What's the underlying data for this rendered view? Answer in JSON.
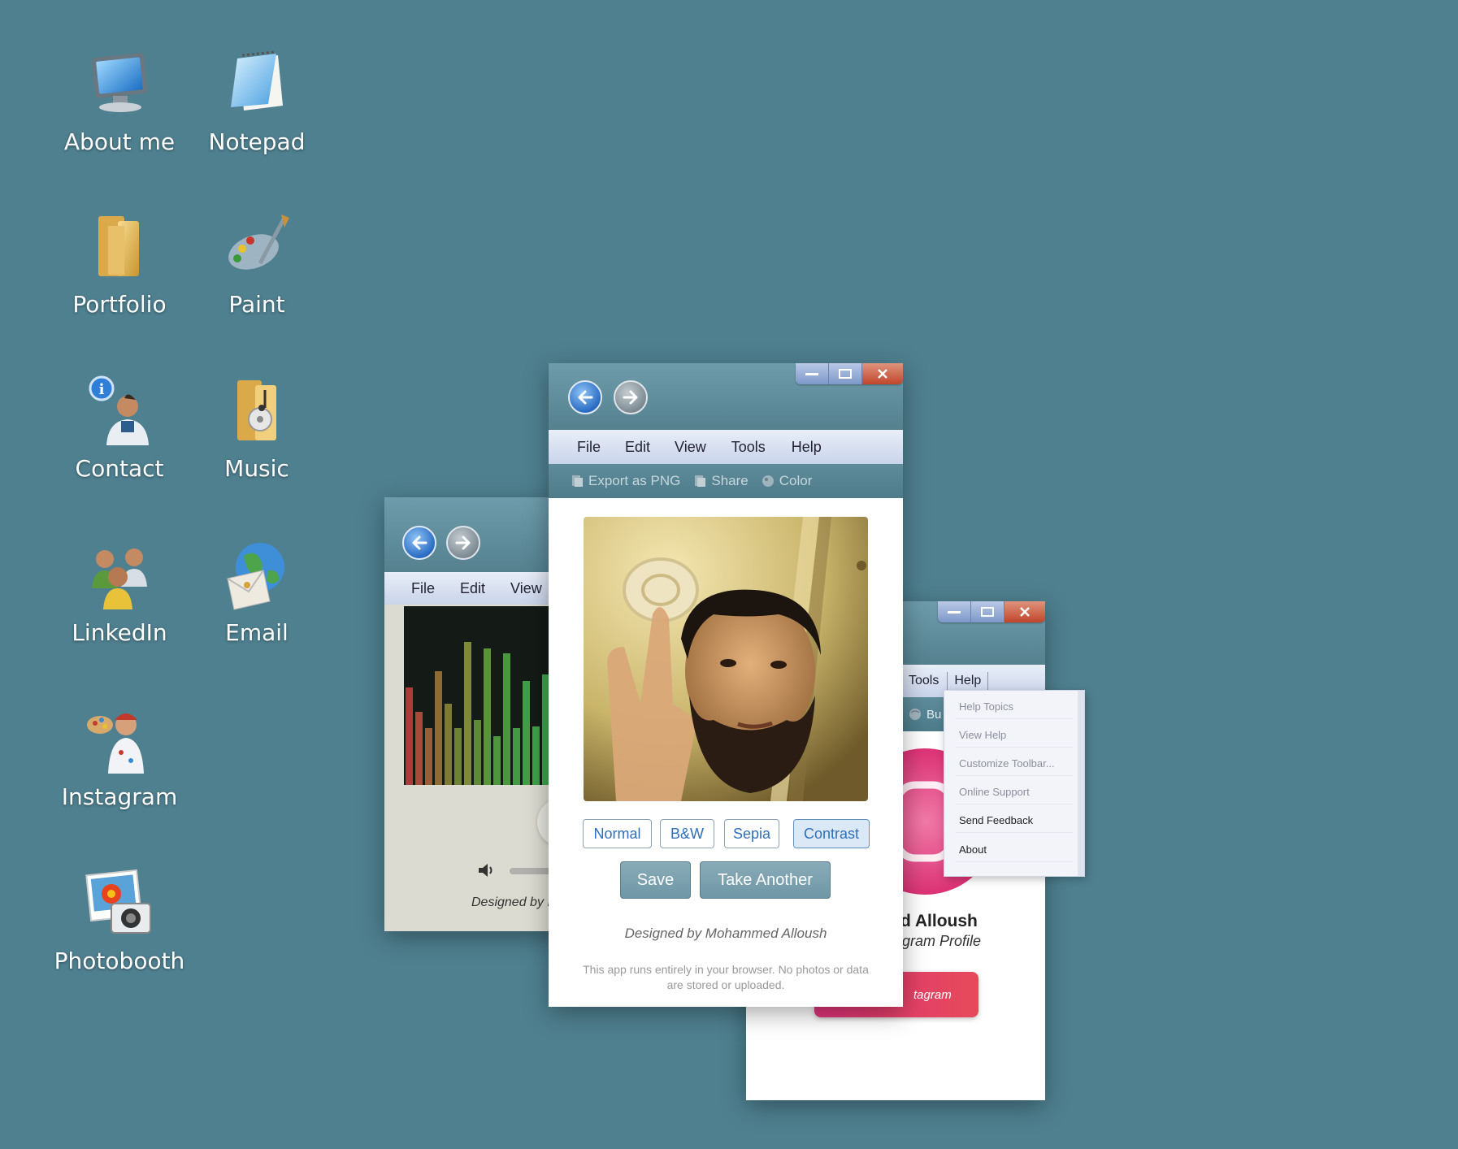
{
  "desktop": {
    "icons": [
      {
        "label": "About me"
      },
      {
        "label": "Notepad"
      },
      {
        "label": "Portfolio"
      },
      {
        "label": "Paint"
      },
      {
        "label": "Contact"
      },
      {
        "label": "Music"
      },
      {
        "label": "LinkedIn"
      },
      {
        "label": "Email"
      },
      {
        "label": "Instagram"
      },
      {
        "label": "Photobooth"
      }
    ]
  },
  "music_window": {
    "menu": [
      "File",
      "Edit",
      "View"
    ],
    "footer": "Designed by I"
  },
  "photobooth_window": {
    "menu": [
      "File",
      "Edit",
      "View",
      "Tools",
      "Help"
    ],
    "toolbar": [
      "Export as PNG",
      "Share",
      "Color"
    ],
    "filters": [
      "Normal",
      "B&W",
      "Sepia",
      "Contrast"
    ],
    "active_filter": "Contrast",
    "save_label": "Save",
    "take_another_label": "Take Another",
    "credit": "Designed by Mohammed Alloush",
    "disclaimer_line1": "This app runs entirely in your browser. No photos or data",
    "disclaimer_line2": "are stored or uploaded."
  },
  "instagram_window": {
    "menu": [
      "Tools",
      "Help"
    ],
    "toolbar_partial": "Bu",
    "name_partial": "d Alloush",
    "subtitle_partial": "gram Profile",
    "button_partial": "tagram"
  },
  "help_menu": {
    "items": [
      "Help Topics",
      "View Help",
      "Customize Toolbar...",
      "Online Support",
      "Send Feedback",
      "About"
    ]
  },
  "colors": {
    "desktop": "#4f8090",
    "accent": "#2f6fba",
    "instagram_pink": "#e0337a"
  }
}
